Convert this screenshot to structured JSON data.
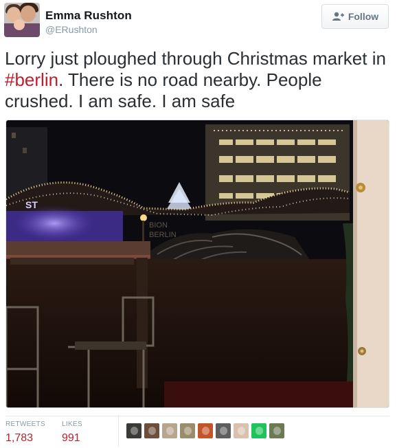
{
  "user": {
    "name": "Emma Rushton",
    "handle": "@ERushton"
  },
  "follow_button": {
    "label": "Follow",
    "icon": "add-user-icon"
  },
  "tweet": {
    "text_before": "Lorry just ploughed through Christmas market in ",
    "hashtag": "#berlin",
    "text_after": ". There is no road nearby. People crushed. I am safe. I am safe"
  },
  "photo_signs": {
    "sign_left": "ST",
    "sign_center_1": "BION",
    "sign_center_2": "BERLIN"
  },
  "stats": {
    "retweets_label": "RETWEETS",
    "retweets_value": "1,783",
    "likes_label": "LIKES",
    "likes_value": "991"
  },
  "likers": [
    {
      "name": "liker-avatar-1",
      "color": "#3c3a36"
    },
    {
      "name": "liker-avatar-2",
      "color": "#6b4f3a"
    },
    {
      "name": "liker-avatar-3",
      "color": "#b8a58f"
    },
    {
      "name": "liker-avatar-4",
      "color": "#9a8c6c"
    },
    {
      "name": "liker-avatar-5",
      "color": "#c0562a"
    },
    {
      "name": "liker-avatar-6",
      "color": "#5e5e5e"
    },
    {
      "name": "liker-avatar-7",
      "color": "#d9c1b0"
    },
    {
      "name": "liker-avatar-8",
      "color": "#21c25e"
    },
    {
      "name": "liker-avatar-9",
      "color": "#6a7a55"
    }
  ],
  "colors": {
    "accent": "#bd1e2d",
    "muted": "#8899a6",
    "text": "#292f33"
  }
}
